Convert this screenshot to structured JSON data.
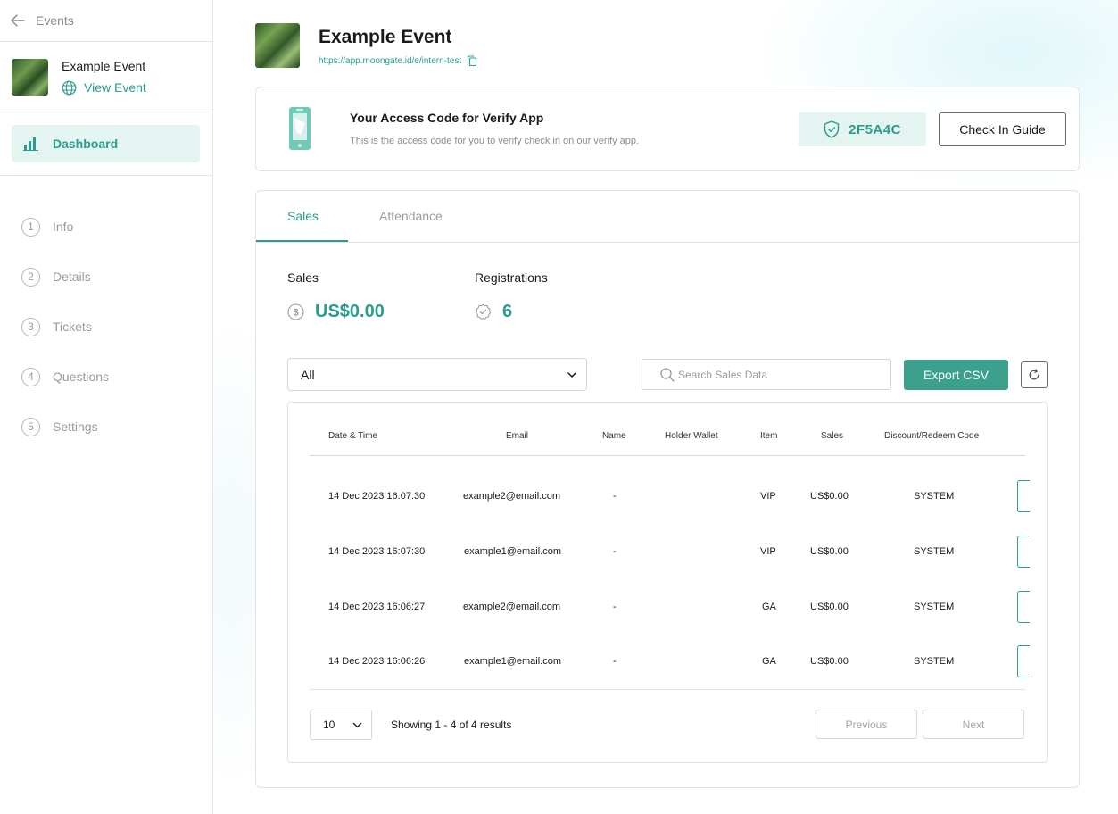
{
  "sidebar": {
    "back_label": "Events",
    "event_name": "Example Event",
    "view_event_label": "View Event",
    "dashboard_label": "Dashboard",
    "steps": [
      {
        "num": "1",
        "label": "Info"
      },
      {
        "num": "2",
        "label": "Details"
      },
      {
        "num": "3",
        "label": "Tickets"
      },
      {
        "num": "4",
        "label": "Questions"
      },
      {
        "num": "5",
        "label": "Settings"
      }
    ]
  },
  "header": {
    "title": "Example Event",
    "url": "https://app.moongate.id/e/intern-test"
  },
  "access": {
    "title": "Your Access Code for Verify App",
    "subtitle": "This is the access code for you to verify check in on our verify app.",
    "code": "2F5A4C",
    "guide_label": "Check In Guide"
  },
  "tabs": {
    "sales": "Sales",
    "attendance": "Attendance"
  },
  "stats": {
    "sales_label": "Sales",
    "sales_value": "US$0.00",
    "registrations_label": "Registrations",
    "registrations_value": "6"
  },
  "toolbar": {
    "filter_value": "All",
    "search_placeholder": "Search Sales Data",
    "export_label": "Export CSV"
  },
  "table": {
    "headers": [
      "Date & Time",
      "Email",
      "Name",
      "Holder Wallet",
      "Item",
      "Sales",
      "Discount/Redeem Code"
    ],
    "rows": [
      {
        "datetime": "14 Dec 2023 16:07:30",
        "email": "example2@email.com",
        "name": "-",
        "wallet": "",
        "item": "VIP",
        "sales": "US$0.00",
        "code": "SYSTEM"
      },
      {
        "datetime": "14 Dec 2023 16:07:30",
        "email": "example1@email.com",
        "name": "-",
        "wallet": "",
        "item": "VIP",
        "sales": "US$0.00",
        "code": "SYSTEM"
      },
      {
        "datetime": "14 Dec 2023 16:06:27",
        "email": "example2@email.com",
        "name": "-",
        "wallet": "",
        "item": "GA",
        "sales": "US$0.00",
        "code": "SYSTEM"
      },
      {
        "datetime": "14 Dec 2023 16:06:26",
        "email": "example1@email.com",
        "name": "-",
        "wallet": "",
        "item": "GA",
        "sales": "US$0.00",
        "code": "SYSTEM"
      }
    ]
  },
  "pagination": {
    "page_size": "10",
    "showing": "Showing 1 - 4 of 4 results",
    "previous": "Previous",
    "next": "Next"
  },
  "colors": {
    "accent": "#2a9d8f",
    "accent_light": "#e3f4f1",
    "button": "#3ba08c"
  }
}
